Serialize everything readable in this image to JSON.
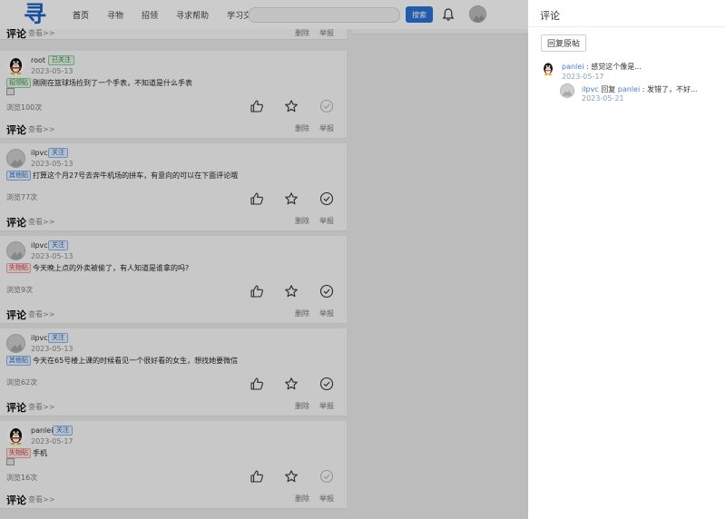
{
  "header": {
    "logo_text": "寻",
    "nav": [
      "首页",
      "寻物",
      "招领",
      "寻求帮助",
      "学习交流"
    ],
    "search_placeholder": "",
    "search_button": "搜索"
  },
  "first_partial": {
    "comment_label": "评论",
    "comment_link": "查看>>",
    "delete": "删除",
    "report": "举报"
  },
  "posts": [
    {
      "user": "root",
      "follow": "已关注",
      "date": "2023-05-13",
      "tag": "招领贴",
      "text": "刚刚在篮球场捡到了一个手表，不知道是什么手表",
      "views": "浏览100次",
      "comment_label": "评论",
      "comment_link": "查看>>",
      "delete": "删除",
      "report": "举报"
    },
    {
      "user": "ilpvc",
      "follow": "关注",
      "date": "2023-05-13",
      "tag": "其他贴",
      "text": "打算这个月27号去奔牛机场的拼车，有意向的可以在下面评论哦",
      "views": "浏览77次",
      "comment_label": "评论",
      "comment_link": "查看>>",
      "delete": "删除",
      "report": "举报"
    },
    {
      "user": "ilpvc",
      "follow": "关注",
      "date": "2023-05-13",
      "tag": "失物贴",
      "text": "今天晚上点的外卖被偷了，有人知道是谁拿的吗?",
      "views": "浏览9次",
      "comment_label": "评论",
      "comment_link": "查看>>",
      "delete": "删除",
      "report": "举报"
    },
    {
      "user": "ilpvc",
      "follow": "关注",
      "date": "2023-05-13",
      "tag": "其他贴",
      "text": "今天在65号楼上课的时候看见一个很好看的女生，想找她要微信",
      "views": "浏览62次",
      "comment_label": "评论",
      "comment_link": "查看>>",
      "delete": "删除",
      "report": "举报"
    },
    {
      "user": "panlei",
      "follow": "关注",
      "date": "2023-05-17",
      "tag": "失物贴",
      "text": "手机",
      "views": "浏览16次",
      "comment_label": "评论",
      "comment_link": "查看>>",
      "delete": "删除",
      "report": "举报"
    }
  ],
  "drawer": {
    "title": "评论",
    "reply_button": "回复原帖",
    "comments": [
      {
        "user": "panlei",
        "sep": " : ",
        "text": "感觉这个像是...",
        "date": "2023-05-17"
      },
      {
        "user": "ilpvc",
        "reply_word": " 回复 ",
        "target": "panlei",
        "sep": " : ",
        "text": "发错了，不好...",
        "date": "2023-05-21"
      }
    ]
  },
  "colors": {
    "accent": "#2a73d8",
    "logo": "#1a66c9"
  }
}
